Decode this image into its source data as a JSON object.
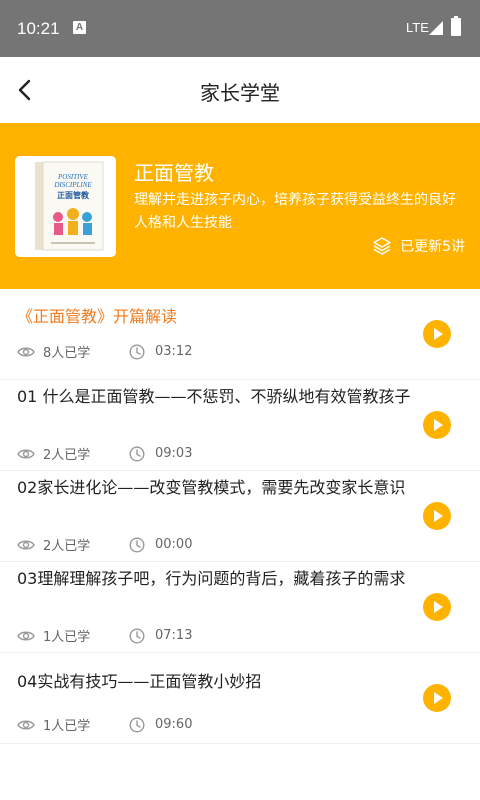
{
  "status_bar": {
    "time": "10:21",
    "notif_icon": "A",
    "network": "LTE"
  },
  "header": {
    "title": "家长学堂",
    "back_icon": "chevron-left-icon"
  },
  "banner": {
    "title": "正面管教",
    "description": "理解并走进孩子内心，培养孩子获得受益终生的良好人格和人生技能",
    "updated": "已更新5讲",
    "background": "#FFB300",
    "cover": {
      "title_line1": "POSITIVE",
      "title_line2": "DISCIPLINE",
      "cn_title": "正面管教"
    }
  },
  "lessons": [
    {
      "title": "《正面管教》开篇解读",
      "views": "8人已学",
      "duration": "03:12",
      "active": true
    },
    {
      "title": "01 什么是正面管教——不惩罚、不骄纵地有效管教孩子",
      "views": "2人已学",
      "duration": "09:03",
      "active": false
    },
    {
      "title": "02家长进化论——改变管教模式，需要先改变家长意识",
      "views": "2人已学",
      "duration": "00:00",
      "active": false
    },
    {
      "title": "03理解理解孩子吧，行为问题的背后，藏着孩子的需求",
      "views": "1人已学",
      "duration": "07:13",
      "active": false
    },
    {
      "title": "04实战有技巧——正面管教小妙招",
      "views": "1人已学",
      "duration": "09:60",
      "active": false
    }
  ],
  "colors": {
    "accent": "#FFB300",
    "active_title": "#F07B1E",
    "meta_text": "#666666"
  }
}
